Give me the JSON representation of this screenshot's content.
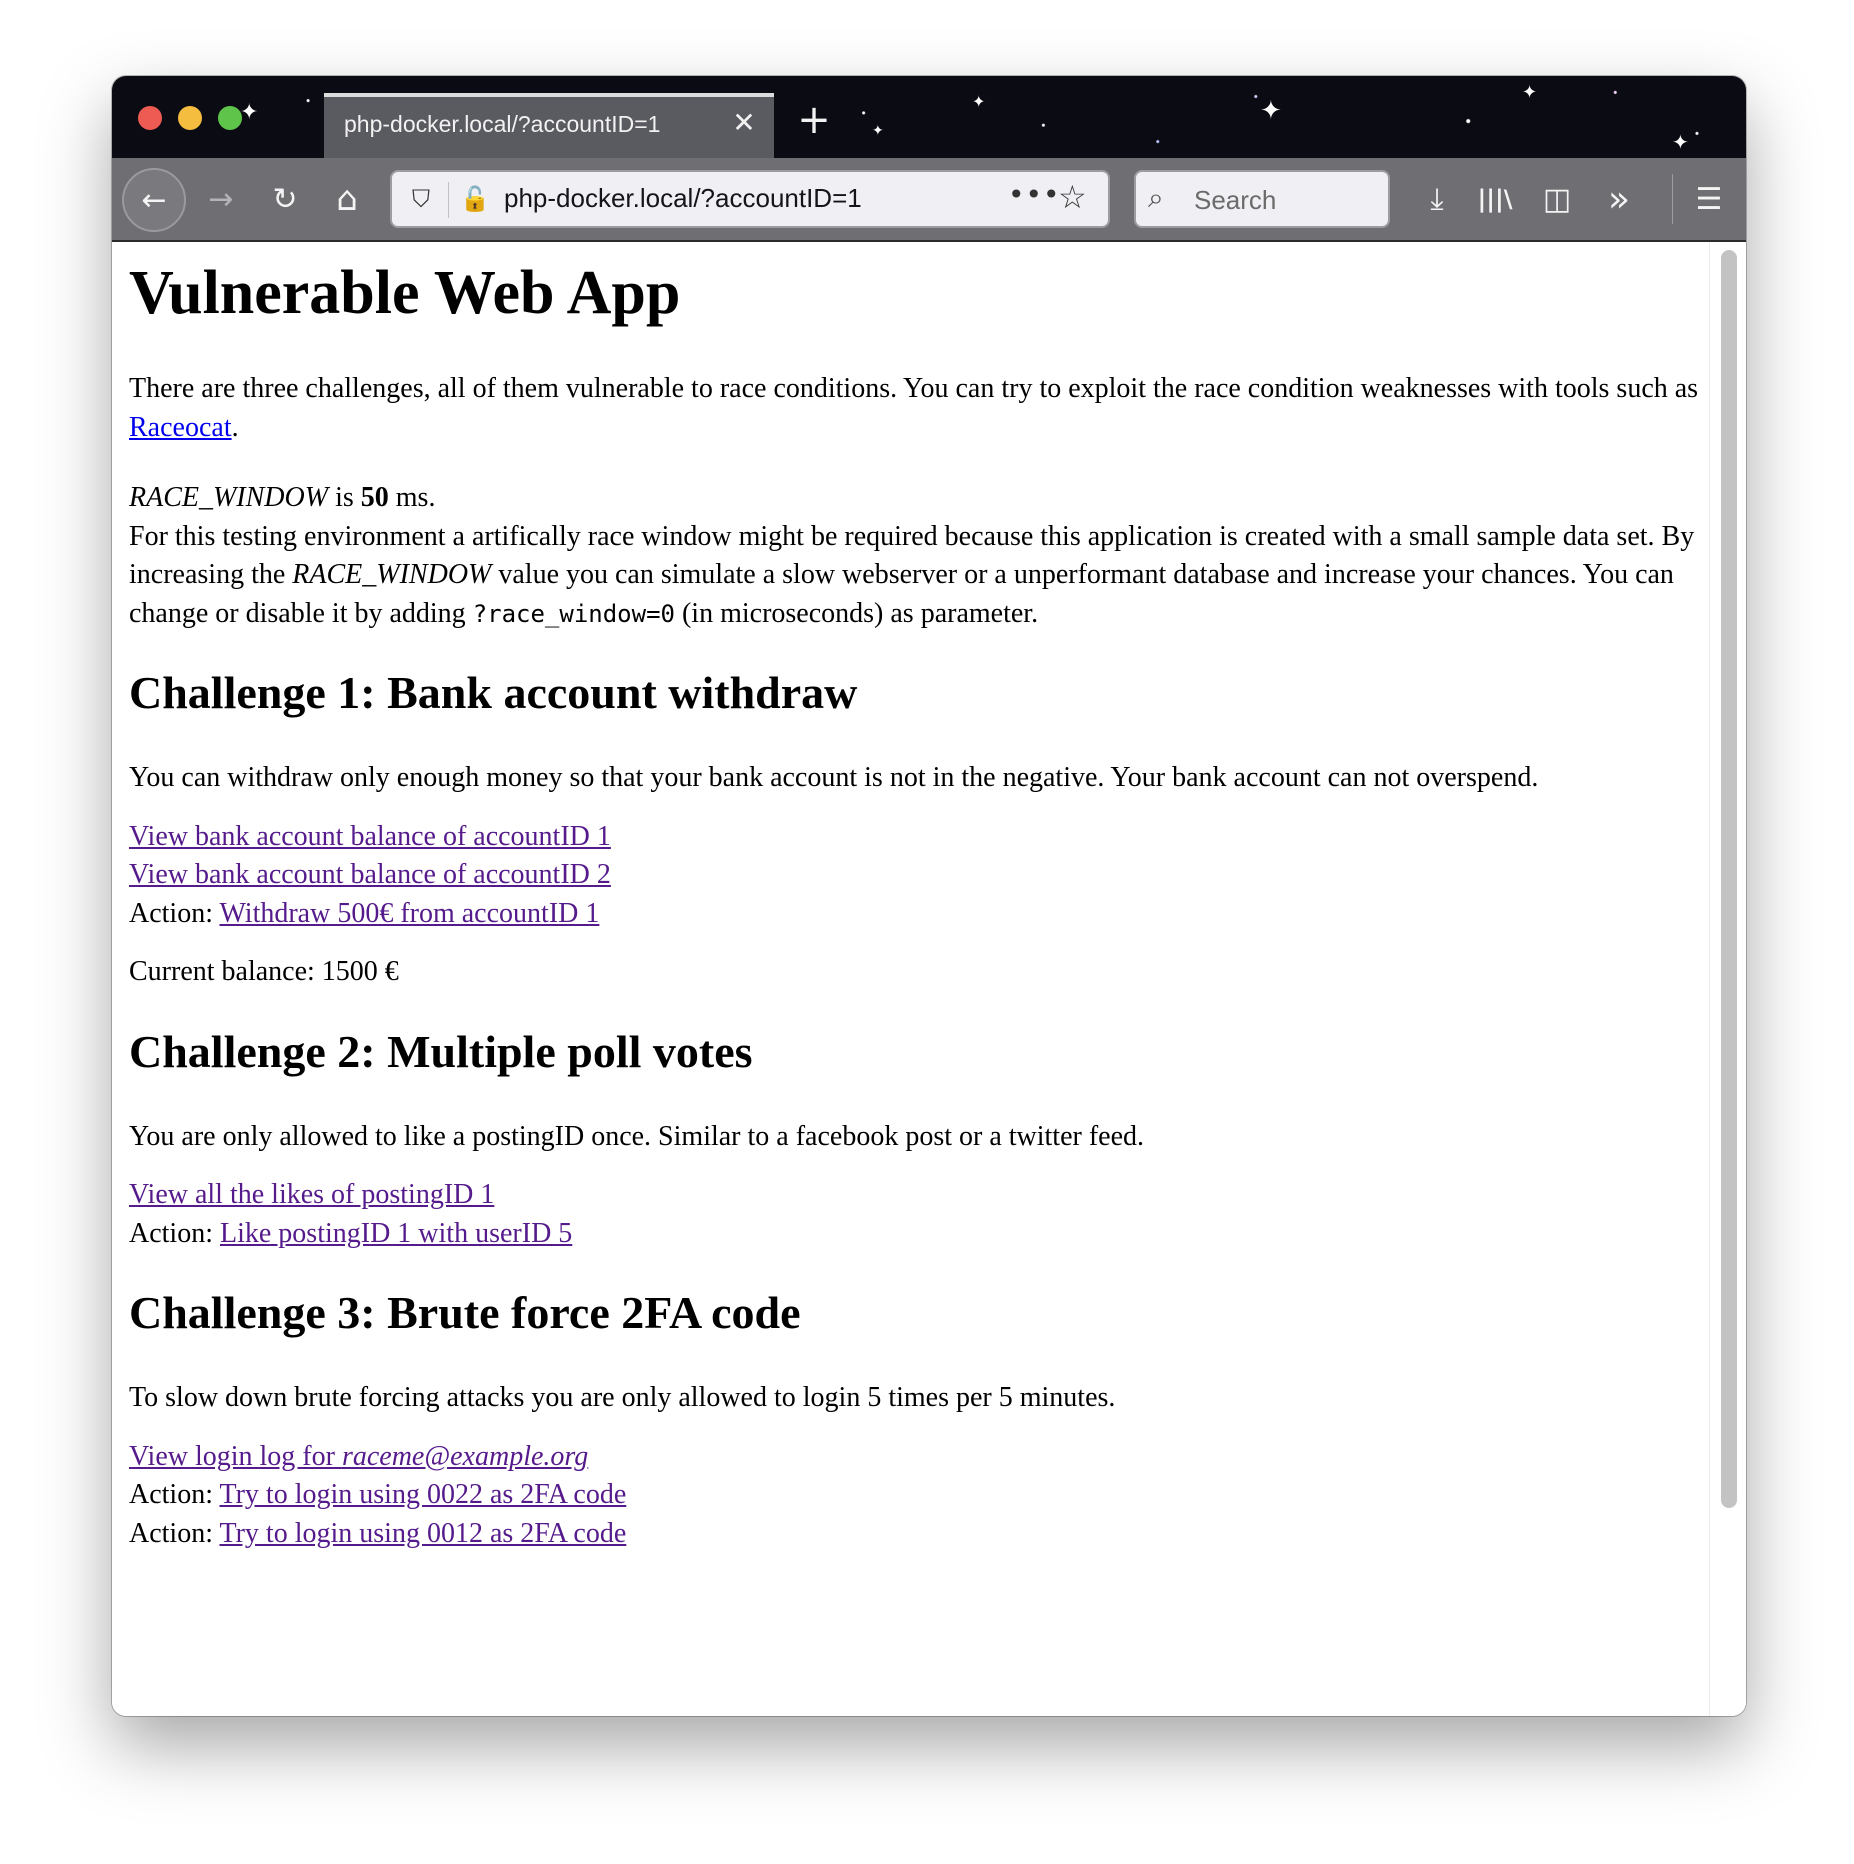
{
  "browser": {
    "tab_title": "php-docker.local/?accountID=1",
    "tab_close": "✕",
    "new_tab": "+",
    "url": "php-docker.local/?accountID=1",
    "url_more": "•••",
    "search_placeholder": "Search",
    "icons": {
      "back": "←",
      "forward": "→",
      "reload": "↻",
      "home": "⌂",
      "shield": "⛉",
      "insecure": "🔓",
      "bookmark": "☆",
      "search": "⌕",
      "downloads": "⤓",
      "library": "|||\\",
      "sidebar": "◫",
      "overflow": "»",
      "menu": "☰"
    },
    "accent": "#551a8b"
  },
  "page": {
    "title": "Vulnerable Web App",
    "intro_text": "There are three challenges, all of them vulnerable to race conditions. You can try to exploit the race condition weaknesses with tools such as ",
    "intro_link": "Raceocat",
    "intro_end": ".",
    "race_window_name": "RACE_WINDOW",
    "race_window_is": " is ",
    "race_window_value": "50",
    "race_window_unit": " ms.",
    "race_desc_1": "For this testing environment a artifically race window might be required because this application is created with a small sample data set. By increasing the ",
    "race_desc_var": "RACE_WINDOW",
    "race_desc_2": " value you can simulate a slow webserver or a unperformant database and increase your chances. You can change or disable it by adding ",
    "race_desc_code": "?race_window=0",
    "race_desc_3": " (in microseconds) as parameter.",
    "challenge1": {
      "heading": "Challenge 1: Bank account withdraw",
      "description": "You can withdraw only enough money so that your bank account is not in the negative. Your bank account can not overspend.",
      "link_view_1": "View bank account balance of accountID 1",
      "link_view_2": "View bank account balance of accountID 2",
      "action_label": "Action: ",
      "link_withdraw": "Withdraw 500€ from accountID 1",
      "balance": "Current balance: 1500 €"
    },
    "challenge2": {
      "heading": "Challenge 2: Multiple poll votes",
      "description": "You are only allowed to like a postingID once. Similar to a facebook post or a twitter feed.",
      "link_view": "View all the likes of postingID 1",
      "action_label": "Action: ",
      "link_like": "Like postingID 1 with userID 5"
    },
    "challenge3": {
      "heading": "Challenge 3: Brute force 2FA code",
      "description": "To slow down brute forcing attacks you are only allowed to login 5 times per 5 minutes.",
      "link_log_prefix": "View login log for ",
      "link_log_email": "raceme@example.org",
      "action_label_1": "Action: ",
      "link_login_1": "Try to login using 0022 as 2FA code",
      "action_label_2": "Action: ",
      "link_login_2": "Try to login using 0012 as 2FA code"
    }
  }
}
